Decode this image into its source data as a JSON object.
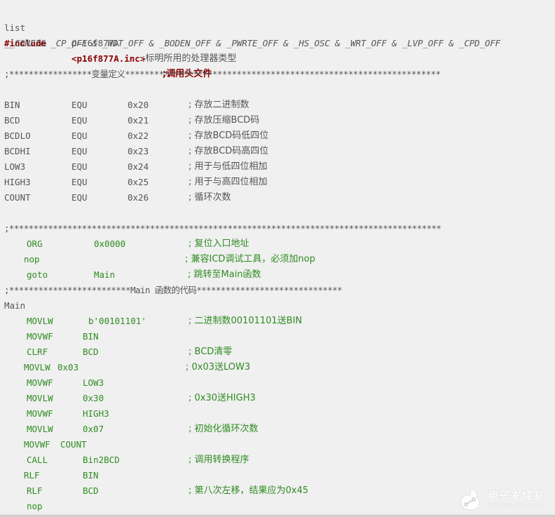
{
  "header": {
    "list_kw": "list",
    "list_val": "p=16f877A",
    "list_comment": ";标明所用的处理器类型",
    "include_kw": "#include",
    "include_val": "<p16f877A.inc>",
    "include_comment": ";调用头文件",
    "config_line": "__CONFIG _CP_OFF & _WDT_OFF & _BODEN_OFF & _PWRTE_OFF & _HS_OSC & _WRT_OFF & _LVP_OFF & _CPD_OFF"
  },
  "var_section": {
    "divider": ";*****************变量定义*****************************************************************",
    "vars": [
      {
        "name": "BIN",
        "op": "EQU",
        "addr": "0x20",
        "comment": "; 存放二进制数"
      },
      {
        "name": "BCD",
        "op": "EQU",
        "addr": "0x21",
        "comment": "; 存放压缩BCD码"
      },
      {
        "name": "BCDLO",
        "op": "EQU",
        "addr": "0x22",
        "comment": "; 存放BCD码低四位"
      },
      {
        "name": "BCDHI",
        "op": "EQU",
        "addr": "0x23",
        "comment": "; 存放BCD码高四位"
      },
      {
        "name": "LOW3",
        "op": "EQU",
        "addr": "0x24",
        "comment": "; 用于与低四位相加"
      },
      {
        "name": "HIGH3",
        "op": "EQU",
        "addr": "0x25",
        "comment": "; 用于与高四位相加"
      },
      {
        "name": "COUNT",
        "op": "EQU",
        "addr": "0x26",
        "comment": "; 循环次数"
      }
    ]
  },
  "init_section": {
    "divider": ";*****************************************************************************************",
    "lines": [
      {
        "op": "ORG",
        "arg": "0x0000",
        "comment": "; 复位入口地址"
      },
      {
        "op": "nop",
        "arg": "",
        "comment": "; 兼容ICD调试工具，必须加nop"
      },
      {
        "op": "goto",
        "arg": "Main",
        "comment": "; 跳转至Main函数"
      }
    ]
  },
  "main_section": {
    "divider": ";*************************Main 函数的代码******************************",
    "label": "Main",
    "lines": [
      {
        "op": "MOVLW",
        "arg": "b'00101101'",
        "comment": "; 二进制数00101101送BIN"
      },
      {
        "op": "MOVWF",
        "arg": "BIN",
        "comment": ""
      },
      {
        "op": "CLRF",
        "arg": "BCD",
        "comment": "; BCD清零"
      },
      {
        "op": "MOVLW",
        "arg": "0x03",
        "comment": "; 0x03送LOW3"
      },
      {
        "op": "MOVWF",
        "arg": "LOW3",
        "comment": ""
      },
      {
        "op": "MOVLW",
        "arg": "0x30",
        "comment": "; 0x30送HIGH3"
      },
      {
        "op": "MOVWF",
        "arg": "HIGH3",
        "comment": ""
      },
      {
        "op": "MOVLW",
        "arg": "0x07",
        "comment": "; 初始化循环次数"
      },
      {
        "op": "MOVWF",
        "arg": "COUNT",
        "comment": ""
      },
      {
        "op": "CALL",
        "arg": "Bin2BCD",
        "comment": "; 调用转换程序"
      },
      {
        "op": "RLF",
        "arg": "BIN",
        "comment": ""
      },
      {
        "op": "RLF",
        "arg": "BCD",
        "comment": "; 第八次左移，结果应为0x45"
      },
      {
        "op": "nop",
        "arg": "",
        "comment": ""
      }
    ]
  },
  "watermark": {
    "name": "电子发烧友",
    "url": "www.elecfans.com"
  },
  "colors": {
    "background": "#f0f0f0",
    "text": "#555555",
    "directive_red": "#8b0000",
    "code_green": "#2e8b20"
  }
}
